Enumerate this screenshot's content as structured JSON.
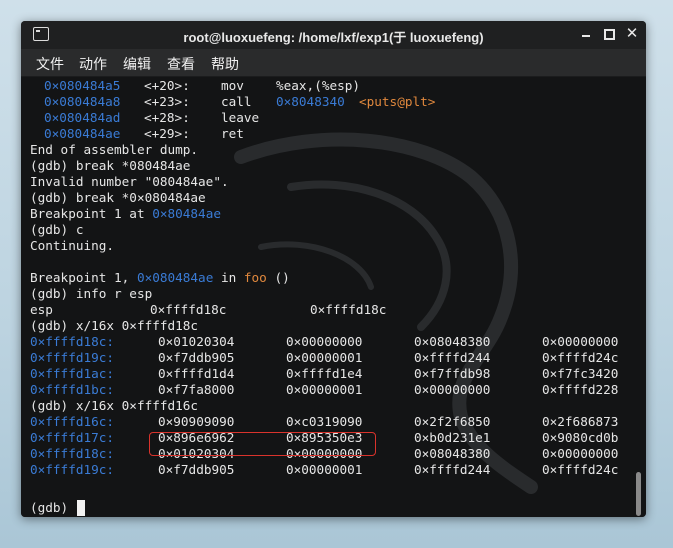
{
  "window": {
    "title": "root@luoxuefeng: /home/lxf/exp1(于 luoxuefeng)"
  },
  "menu": [
    "文件",
    "动作",
    "编辑",
    "查看",
    "帮助"
  ],
  "terminal": {
    "disasm": [
      {
        "addr": "0×080484a5",
        "off": "<+20>:",
        "op": "mov",
        "arg": "%eax,(%esp)"
      },
      {
        "addr": "0×080484a8",
        "off": "<+23>:",
        "op": "call",
        "arg": "0×8048340",
        "sym": "<puts@plt>"
      },
      {
        "addr": "0×080484ad",
        "off": "<+28>:",
        "op": "leave"
      },
      {
        "addr": "0×080484ae",
        "off": "<+29>:",
        "op": "ret"
      }
    ],
    "text1": [
      "End of assembler dump.",
      "(gdb) break *080484ae",
      "Invalid number \"080484ae\".",
      "(gdb) break *0×080484ae"
    ],
    "bp1_prefix": "Breakpoint 1 at ",
    "bp1_addr": "0×80484ae",
    "cmd_c": "(gdb) c",
    "continuing": "Continuing.",
    "bp_hit_prefix": "Breakpoint 1, ",
    "bp_hit_addr": "0×080484ae",
    "bp_hit_in": " in ",
    "bp_hit_fn": "foo",
    "bp_hit_tail": " ()",
    "cmd_info": "(gdb) info r esp",
    "esp_reg": "esp",
    "esp_val1": "0×ffffd18c",
    "esp_val2": "0×ffffd18c",
    "cmd_x1": "(gdb) x/16x 0×ffffd18c",
    "dump1": [
      {
        "addr": "0×ffffd18c:",
        "v": [
          "0×01020304",
          "0×00000000",
          "0×08048380",
          "0×00000000"
        ]
      },
      {
        "addr": "0×ffffd19c:",
        "v": [
          "0×f7ddb905",
          "0×00000001",
          "0×ffffd244",
          "0×ffffd24c"
        ]
      },
      {
        "addr": "0×ffffd1ac:",
        "v": [
          "0×ffffd1d4",
          "0×ffffd1e4",
          "0×f7ffdb98",
          "0×f7fc3420"
        ]
      },
      {
        "addr": "0×ffffd1bc:",
        "v": [
          "0×f7fa8000",
          "0×00000001",
          "0×00000000",
          "0×ffffd228"
        ]
      }
    ],
    "cmd_x2": "(gdb) x/16x 0×ffffd16c",
    "dump2": [
      {
        "addr": "0×ffffd16c:",
        "v": [
          "0×90909090",
          "0×c0319090",
          "0×2f2f6850",
          "0×2f686873"
        ]
      },
      {
        "addr": "0×ffffd17c:",
        "v": [
          "0×896e6962",
          "0×895350e3",
          "0×b0d231e1",
          "0×9080cd0b"
        ]
      },
      {
        "addr": "0×ffffd18c:",
        "v": [
          "0×01020304",
          "0×00000000",
          "0×08048380",
          "0×00000000"
        ]
      },
      {
        "addr": "0×ffffd19c:",
        "v": [
          "0×f7ddb905",
          "0×00000001",
          "0×ffffd244",
          "0×ffffd24c"
        ]
      }
    ],
    "prompt": "(gdb)"
  }
}
